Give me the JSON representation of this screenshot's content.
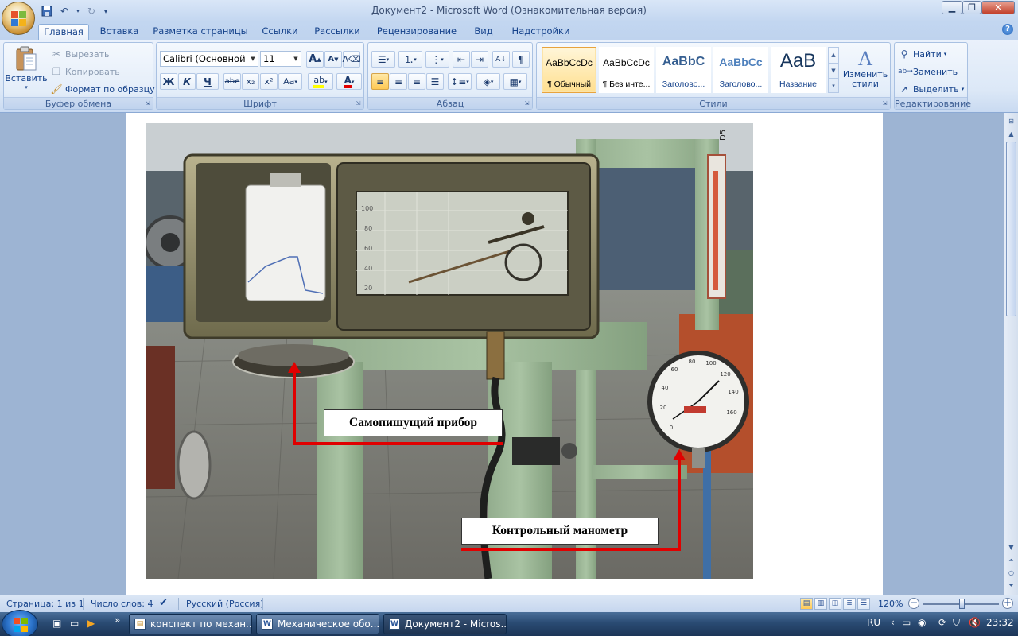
{
  "window": {
    "title": "Документ2 - Microsoft Word (Ознакомительная версия)"
  },
  "tabs": [
    "Главная",
    "Вставка",
    "Разметка страницы",
    "Ссылки",
    "Рассылки",
    "Рецензирование",
    "Вид",
    "Надстройки"
  ],
  "clipboard": {
    "label": "Буфер обмена",
    "paste": "Вставить",
    "cut": "Вырезать",
    "copy": "Копировать",
    "format_painter": "Формат по образцу"
  },
  "font": {
    "label": "Шрифт",
    "name": "Calibri (Основной текст)",
    "size": "11",
    "bold": "Ж",
    "italic": "К",
    "underline": "Ч",
    "strike": "abe",
    "subscript": "x₂",
    "superscript": "x²",
    "case": "Aa",
    "grow": "A",
    "shrink": "A"
  },
  "paragraph": {
    "label": "Абзац"
  },
  "styles": {
    "label": "Стили",
    "items": [
      {
        "sample": "AaBbCcDc",
        "name": "¶ Обычный"
      },
      {
        "sample": "AaBbCcDc",
        "name": "¶ Без инте..."
      },
      {
        "sample": "AaBbC",
        "name": "Заголово..."
      },
      {
        "sample": "AaBbCc",
        "name": "Заголово..."
      },
      {
        "sample": "AaB",
        "name": "Название"
      }
    ],
    "change": "Изменить стили"
  },
  "editing": {
    "label": "Редактирование",
    "find": "Найти",
    "replace": "Заменить",
    "select": "Выделить"
  },
  "document": {
    "callout_recorder": "Самопишущий прибор",
    "callout_manometer": "Контрольный манометр",
    "gauge_ticks": [
      "0",
      "20",
      "40",
      "60",
      "80",
      "100",
      "120",
      "140",
      "160"
    ],
    "chart_ticks": [
      "100",
      "80",
      "60",
      "40",
      "20"
    ],
    "ruler_label": "D5"
  },
  "statusbar": {
    "page": "Страница: 1 из 1",
    "words": "Число слов: 4",
    "language": "Русский (Россия)",
    "zoom": "120%"
  },
  "taskbar": {
    "items": [
      {
        "label": "конспект по механ..."
      },
      {
        "label": "Механическое обо..."
      },
      {
        "label": "Документ2 - Micros..."
      }
    ],
    "lang": "RU",
    "clock": "23:32"
  },
  "colors": {
    "callout_red": "#e00000",
    "selected_style": "#ffdf8f",
    "ribbon_text": "#15428b"
  }
}
